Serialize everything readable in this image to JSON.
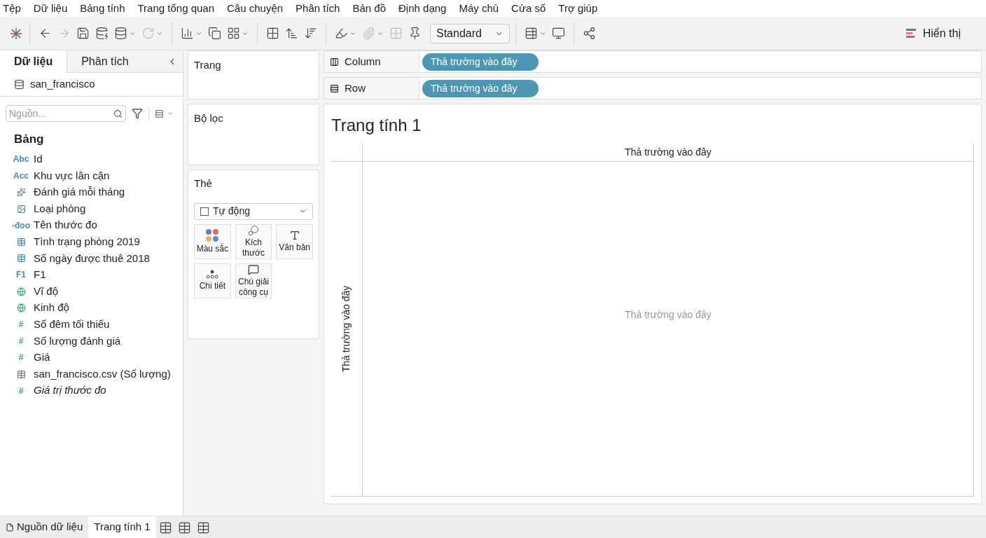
{
  "menu": [
    "Tệp",
    "Dữ liệu",
    "Bảng tính",
    "Trang tổng quan",
    "Câu chuyện",
    "Phân tích",
    "Bản đồ",
    "Định dạng",
    "Máy chủ",
    "Cửa sổ",
    "Trợ giúp"
  ],
  "toolbar": {
    "mark_type": "Standard",
    "show_me": "Hiển thị"
  },
  "side_tabs": [
    {
      "label": "Dữ liệu",
      "selected": true
    },
    {
      "label": "Phân tích",
      "selected": false
    }
  ],
  "data_source": "san_francisco",
  "search": {
    "placeholder": "Nguồn..."
  },
  "section": "Bảng",
  "fields": [
    {
      "name": "Id",
      "kind": "glyph",
      "glyph": "Abc",
      "color": "#4a8bb5",
      "italic": false
    },
    {
      "name": "Khu vực lân cận",
      "kind": "glyph",
      "glyph": "Acc",
      "color": "#4a8bb5",
      "italic": false
    },
    {
      "name": "Đánh giá mỗi tháng",
      "kind": "geo",
      "color": "#4a8bb5",
      "italic": false
    },
    {
      "name": "Loại phòng",
      "kind": "image",
      "color": "#4a8bb5",
      "italic": false
    },
    {
      "name": "Tên thước đo",
      "kind": "glyph",
      "glyph": "-đoo",
      "color": "#4a8bb5",
      "italic": false
    },
    {
      "name": "Tình trạng phòng 2019",
      "kind": "table",
      "color": "#4a8bb5",
      "italic": false
    },
    {
      "name": "Số ngày được thuê 2018",
      "kind": "table",
      "color": "#4a8bb5",
      "italic": false
    },
    {
      "name": "F1",
      "kind": "glyph",
      "glyph": "F1",
      "color": "#4a8bb5",
      "italic": false
    },
    {
      "name": "Vĩ độ",
      "kind": "globe",
      "color": "#3aa388",
      "italic": false
    },
    {
      "name": "Kinh độ",
      "kind": "globe",
      "color": "#3aa388",
      "italic": false
    },
    {
      "name": "Số đêm tối thiểu",
      "kind": "glyph",
      "glyph": "#",
      "color": "#3aa388",
      "italic": false
    },
    {
      "name": "Số lượng đánh giá",
      "kind": "glyph",
      "glyph": "#",
      "color": "#3aa388",
      "italic": false
    },
    {
      "name": "Giá",
      "kind": "glyph",
      "glyph": "#",
      "color": "#3aa388",
      "italic": false
    },
    {
      "name": "san_francisco.csv (Số lượng)",
      "kind": "table",
      "color": "#777777",
      "italic": false
    },
    {
      "name": "Giá trị thước đo",
      "kind": "glyph",
      "glyph": "#",
      "color": "#3aa388",
      "italic": true
    }
  ],
  "pages": {
    "title": "Trang"
  },
  "filters": {
    "title": "Bộ lọc"
  },
  "marks": {
    "title": "Thẻ",
    "mark_type": "Tự động",
    "buttons": [
      {
        "label": "Màu sắc",
        "kind": "color"
      },
      {
        "label": "Kích thước",
        "kind": "size"
      },
      {
        "label": "Văn bản",
        "kind": "text"
      },
      {
        "label": "Chi tiết",
        "kind": "detail"
      },
      {
        "label": "Chú giải công cụ",
        "kind": "tooltip"
      }
    ]
  },
  "shelves": [
    {
      "label": "Column",
      "kind": "columns",
      "pill": "Thả trường vào đây"
    },
    {
      "label": "Row",
      "kind": "rows",
      "pill": "Thả trường vào đây"
    }
  ],
  "sheet": {
    "title": "Trang tính 1",
    "top_drop": "Thả trường vào đây",
    "left_drop": "Thả trường vào đây",
    "center_drop": "Thả trường vào đây"
  },
  "bottom_tabs": [
    {
      "label": "Nguồn dữ liệu",
      "kind": "source",
      "selected": false
    },
    {
      "label": "Trang tính 1",
      "kind": "sheet",
      "selected": true
    }
  ]
}
